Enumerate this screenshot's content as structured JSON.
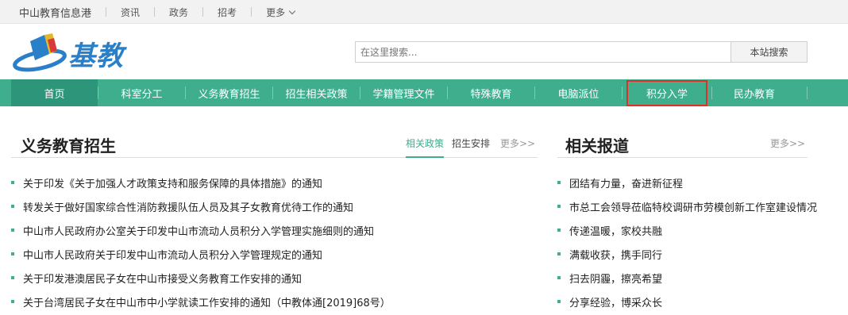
{
  "topbar": {
    "site_name": "中山教育信息港",
    "links": [
      "资讯",
      "政务",
      "招考"
    ],
    "more_label": "更多"
  },
  "header": {
    "logo_text": "基教",
    "search_placeholder": "在这里搜索...",
    "search_button": "本站搜索"
  },
  "nav": {
    "items": [
      "首页",
      "科室分工",
      "义务教育招生",
      "招生相关政策",
      "学籍管理文件",
      "特殊教育",
      "电脑派位",
      "积分入学",
      "民办教育"
    ]
  },
  "left_section": {
    "title": "义务教育招生",
    "tab_active": "相关政策",
    "tab_other": "招生安排",
    "more": "更多>>",
    "items": [
      "关于印发《关于加强人才政策支持和服务保障的具体措施》的通知",
      "转发关于做好国家综合性消防救援队伍人员及其子女教育优待工作的通知",
      "中山市人民政府办公室关于印发中山市流动人员积分入学管理实施细则的通知",
      "中山市人民政府关于印发中山市流动人员积分入学管理规定的通知",
      "关于印发港澳居民子女在中山市接受义务教育工作安排的通知",
      "关于台湾居民子女在中山市中小学就读工作安排的通知（中教体通[2019]68号）"
    ]
  },
  "right_section": {
    "title": "相关报道",
    "more": "更多>>",
    "items": [
      "团结有力量，奋进新征程",
      "市总工会领导莅临特校调研市劳模创新工作室建设情况",
      "传递温暖，家校共融",
      "满载收获，携手同行",
      "扫去阴霾，擦亮希望",
      "分享经验，博采众长"
    ]
  },
  "colors": {
    "accent": "#3eae8d",
    "nav_active": "#2d957a",
    "highlight_border": "#e0302a",
    "logo_blue": "#2a7fc9"
  }
}
